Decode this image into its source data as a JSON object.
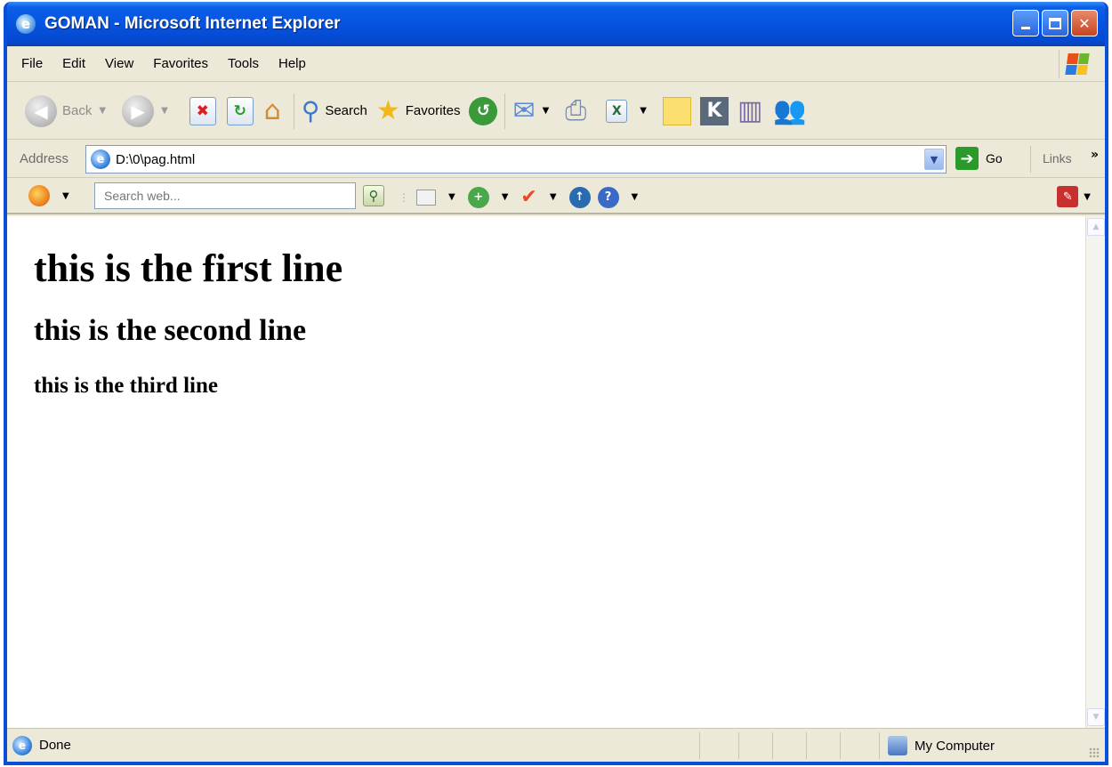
{
  "window": {
    "title": "GOMAN - Microsoft Internet Explorer"
  },
  "menu": {
    "items": [
      "File",
      "Edit",
      "View",
      "Favorites",
      "Tools",
      "Help"
    ]
  },
  "toolbar": {
    "back_label": "Back",
    "search_label": "Search",
    "favorites_label": "Favorites"
  },
  "address": {
    "label": "Address",
    "value": "D:\\0\\pag.html",
    "go_label": "Go",
    "links_label": "Links"
  },
  "search_toolbar": {
    "placeholder": "Search web..."
  },
  "page": {
    "line1": "this is the first line",
    "line2": "this is the second line",
    "line3": "this is the third line"
  },
  "status": {
    "text": "Done",
    "zone": "My Computer"
  },
  "colors": {
    "titlebar": "#0654e0",
    "chrome": "#ece9d8",
    "close": "#c84420",
    "go": "#2a9a2a"
  }
}
